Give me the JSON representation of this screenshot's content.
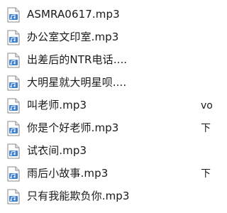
{
  "files": [
    {
      "name": "ASMRA0617.mp3",
      "extra": "",
      "icon": "audio-file-icon"
    },
    {
      "name": "办公室文印室.mp3",
      "extra": "",
      "icon": "audio-file-icon"
    },
    {
      "name": "出差后的NTR电话....",
      "extra": "",
      "icon": "audio-file-icon"
    },
    {
      "name": "大明星就大明星呗....",
      "extra": "",
      "icon": "audio-file-icon"
    },
    {
      "name": "叫老师.mp3",
      "extra": "vo",
      "icon": "audio-file-icon"
    },
    {
      "name": "你是个好老师.mp3",
      "extra": "下",
      "icon": "audio-file-icon"
    },
    {
      "name": "试衣间.mp3",
      "extra": "",
      "icon": "audio-file-icon"
    },
    {
      "name": "雨后小故事.mp3",
      "extra": "下",
      "icon": "audio-file-icon"
    },
    {
      "name": "只有我能欺负你.mp3",
      "extra": "",
      "icon": "audio-file-icon"
    }
  ],
  "colors": {
    "icon_page": "#ffffff",
    "icon_border": "#8a8a8a",
    "icon_accent": "#3d7fd4",
    "text": "#1a1a1a"
  }
}
